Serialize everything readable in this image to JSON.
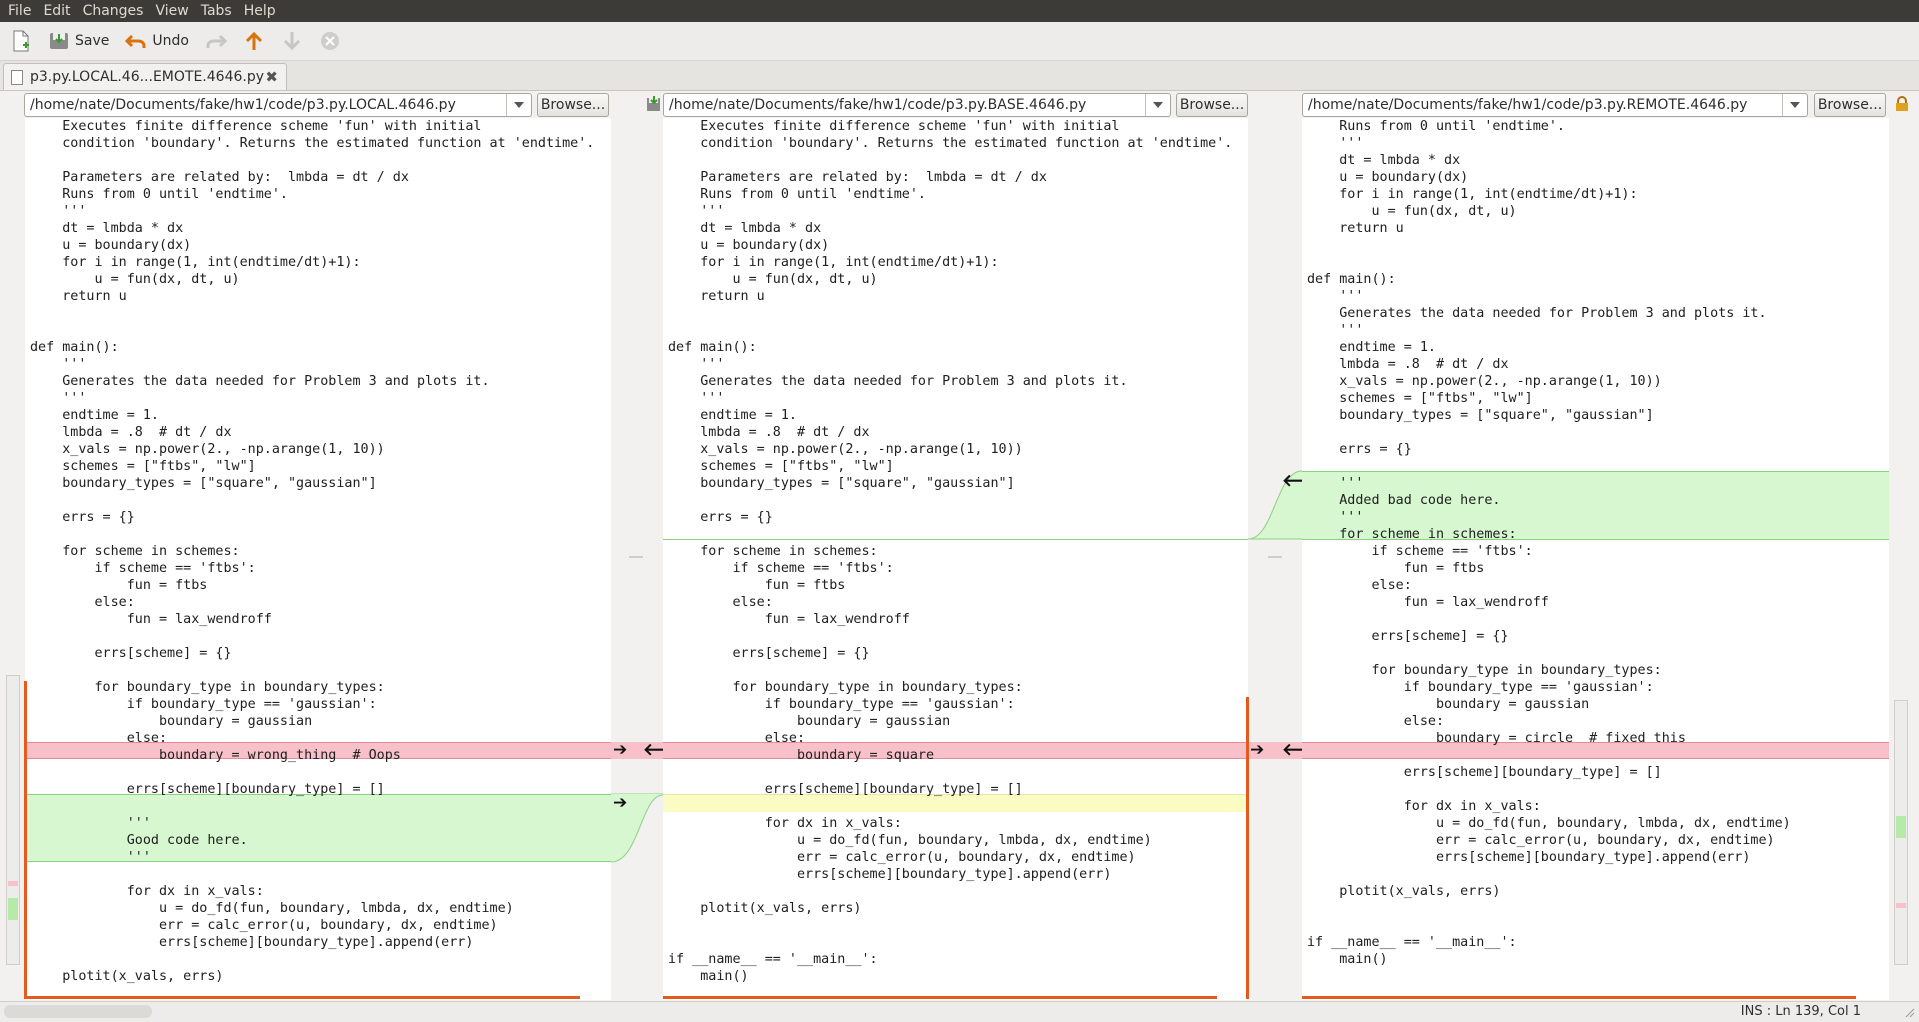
{
  "menu": [
    "File",
    "Edit",
    "Changes",
    "View",
    "Tabs",
    "Help"
  ],
  "toolbar": {
    "save_label": "Save",
    "undo_label": "Undo"
  },
  "tab": {
    "label": "p3.py.LOCAL.46...EMOTE.4646.py"
  },
  "panes": [
    {
      "path": "/home/nate/Documents/fake/hw1/code/p3.py.LOCAL.4646.py",
      "browse": "Browse..."
    },
    {
      "path": "/home/nate/Documents/fake/hw1/code/p3.py.BASE.4646.py",
      "browse": "Browse..."
    },
    {
      "path": "/home/nate/Documents/fake/hw1/code/p3.py.REMOTE.4646.py",
      "browse": "Browse..."
    }
  ],
  "code": {
    "left": [
      "    Executes finite difference scheme 'fun' with initial",
      "    condition 'boundary'. Returns the estimated function at 'endtime'.",
      "",
      "    Parameters are related by:  lmbda = dt / dx",
      "    Runs from 0 until 'endtime'.",
      "    '''",
      "    dt = lmbda * dx",
      "    u = boundary(dx)",
      "    for i in range(1, int(endtime/dt)+1):",
      "        u = fun(dx, dt, u)",
      "    return u",
      "",
      "",
      "def main():",
      "    '''",
      "    Generates the data needed for Problem 3 and plots it.",
      "    '''",
      "    endtime = 1.",
      "    lmbda = .8  # dt / dx",
      "    x_vals = np.power(2., -np.arange(1, 10))",
      "    schemes = [\"ftbs\", \"lw\"]",
      "    boundary_types = [\"square\", \"gaussian\"]",
      "",
      "    errs = {}",
      "",
      "    for scheme in schemes:",
      "        if scheme == 'ftbs':",
      "            fun = ftbs",
      "        else:",
      "            fun = lax_wendroff",
      "",
      "        errs[scheme] = {}",
      "",
      "        for boundary_type in boundary_types:",
      "            if boundary_type == 'gaussian':",
      "                boundary = gaussian",
      "            else:",
      "                boundary = wrong_thing  # Oops",
      "",
      "            errs[scheme][boundary_type] = []",
      "",
      "            '''",
      "            Good code here.",
      "            '''",
      "",
      "            for dx in x_vals:",
      "                u = do_fd(fun, boundary, lmbda, dx, endtime)",
      "                err = calc_error(u, boundary, dx, endtime)",
      "                errs[scheme][boundary_type].append(err)",
      "",
      "    plotit(x_vals, errs)"
    ],
    "base": [
      "    Executes finite difference scheme 'fun' with initial",
      "    condition 'boundary'. Returns the estimated function at 'endtime'.",
      "",
      "    Parameters are related by:  lmbda = dt / dx",
      "    Runs from 0 until 'endtime'.",
      "    '''",
      "    dt = lmbda * dx",
      "    u = boundary(dx)",
      "    for i in range(1, int(endtime/dt)+1):",
      "        u = fun(dx, dt, u)",
      "    return u",
      "",
      "",
      "def main():",
      "    '''",
      "    Generates the data needed for Problem 3 and plots it.",
      "    '''",
      "    endtime = 1.",
      "    lmbda = .8  # dt / dx",
      "    x_vals = np.power(2., -np.arange(1, 10))",
      "    schemes = [\"ftbs\", \"lw\"]",
      "    boundary_types = [\"square\", \"gaussian\"]",
      "",
      "    errs = {}",
      "",
      "    for scheme in schemes:",
      "        if scheme == 'ftbs':",
      "            fun = ftbs",
      "        else:",
      "            fun = lax_wendroff",
      "",
      "        errs[scheme] = {}",
      "",
      "        for boundary_type in boundary_types:",
      "            if boundary_type == 'gaussian':",
      "                boundary = gaussian",
      "            else:",
      "                boundary = square",
      "",
      "            errs[scheme][boundary_type] = []",
      "",
      "            for dx in x_vals:",
      "                u = do_fd(fun, boundary, lmbda, dx, endtime)",
      "                err = calc_error(u, boundary, dx, endtime)",
      "                errs[scheme][boundary_type].append(err)",
      "",
      "    plotit(x_vals, errs)",
      "",
      "",
      "if __name__ == '__main__':",
      "    main()"
    ],
    "remote": [
      "    Runs from 0 until 'endtime'.",
      "    '''",
      "    dt = lmbda * dx",
      "    u = boundary(dx)",
      "    for i in range(1, int(endtime/dt)+1):",
      "        u = fun(dx, dt, u)",
      "    return u",
      "",
      "",
      "def main():",
      "    '''",
      "    Generates the data needed for Problem 3 and plots it.",
      "    '''",
      "    endtime = 1.",
      "    lmbda = .8  # dt / dx",
      "    x_vals = np.power(2., -np.arange(1, 10))",
      "    schemes = [\"ftbs\", \"lw\"]",
      "    boundary_types = [\"square\", \"gaussian\"]",
      "",
      "    errs = {}",
      "",
      "    '''",
      "    Added bad code here.",
      "    '''",
      "    for scheme in schemes:",
      "        if scheme == 'ftbs':",
      "            fun = ftbs",
      "        else:",
      "            fun = lax_wendroff",
      "",
      "        errs[scheme] = {}",
      "",
      "        for boundary_type in boundary_types:",
      "            if boundary_type == 'gaussian':",
      "                boundary = gaussian",
      "            else:",
      "                boundary = circle  # fixed this",
      "",
      "            errs[scheme][boundary_type] = []",
      "",
      "            for dx in x_vals:",
      "                u = do_fd(fun, boundary, lmbda, dx, endtime)",
      "                err = calc_error(u, boundary, dx, endtime)",
      "                errs[scheme][boundary_type].append(err)",
      "",
      "    plotit(x_vals, errs)",
      "",
      "",
      "if __name__ == '__main__':",
      "    main()"
    ]
  },
  "status": {
    "text": "INS : Ln 139, Col 1"
  },
  "colors": {
    "deleted_bg": "#f8c1c9",
    "inserted_bg": "#d6f7d0",
    "conflict_bar": "#e55a1e",
    "menubar_bg": "#3c3b37"
  }
}
